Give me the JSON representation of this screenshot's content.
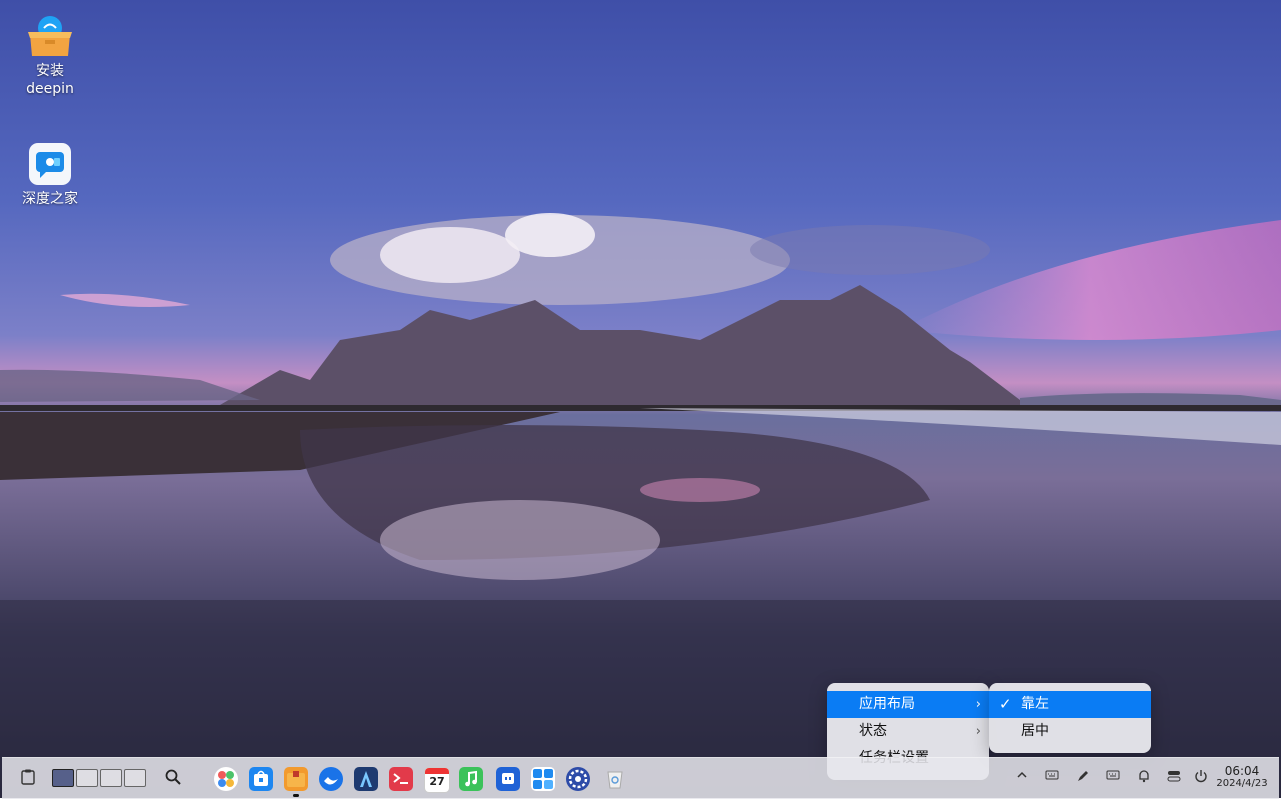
{
  "desktop": {
    "icons": [
      {
        "label_line1": "安装",
        "label_line2": "deepin",
        "icon": "package-install-icon"
      },
      {
        "label_line1": "深度之家",
        "icon": "deepin-home-icon"
      }
    ]
  },
  "context_menu": {
    "items": [
      {
        "label": "应用布局",
        "has_submenu": true,
        "active": true
      },
      {
        "label": "状态",
        "has_submenu": true,
        "active": false
      },
      {
        "label": "任务栏设置",
        "has_submenu": false,
        "active": false
      }
    ],
    "arrow_glyph": "›"
  },
  "submenu": {
    "items": [
      {
        "label": "靠左",
        "checked": true
      },
      {
        "label": "居中",
        "checked": false
      }
    ],
    "check_glyph": "✓"
  },
  "taskbar": {
    "clock_time": "06:04",
    "clock_date": "2024/4/23",
    "calendar_day": "27",
    "apps": [
      "launcher-icon",
      "app-store-icon",
      "file-manager-icon",
      "browser-icon",
      "text-editor-icon",
      "terminal-icon",
      "calendar-icon",
      "music-icon",
      "notes-icon",
      "calculator-icon",
      "settings-icon",
      "trash-icon"
    ],
    "accent": "#0a7cf4"
  }
}
